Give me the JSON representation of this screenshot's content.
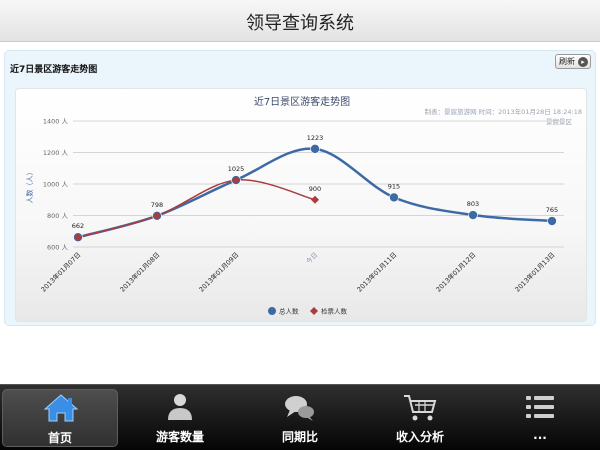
{
  "header": {
    "title": "领导查询系统"
  },
  "panel": {
    "title": "近7日景区游客走势图",
    "refresh_label": "刷新"
  },
  "chart_data": {
    "type": "line",
    "title": "近7日景区游客走势图",
    "credit_line1": "制表：景宸旅游网 时间：2013年01月28日 18:24:18",
    "credit_line2": "景宸景区",
    "ylabel": "人数（人）",
    "ylim": [
      600,
      1400
    ],
    "yticks": [
      {
        "value": 600,
        "label": "600 人"
      },
      {
        "value": 800,
        "label": "800 人"
      },
      {
        "value": 1000,
        "label": "1000 人"
      },
      {
        "value": 1200,
        "label": "1200 人"
      },
      {
        "value": 1400,
        "label": "1400 人"
      }
    ],
    "categories": [
      "2013年01月07日",
      "2013年01月08日",
      "2013年01月09日",
      "今日",
      "2013年01月11日",
      "2013年01月12日",
      "2013年01月13日"
    ],
    "series": [
      {
        "name": "总人数",
        "color": "#3d6aa5",
        "marker": "circle",
        "values": [
          662,
          798,
          1025,
          1223,
          915,
          803,
          765
        ],
        "labels": [
          "662",
          "798",
          "1025",
          "1223",
          "915",
          "803",
          "765"
        ]
      },
      {
        "name": "检票人数",
        "color": "#aa3c3c",
        "marker": "diamond",
        "values": [
          662,
          798,
          1025,
          900
        ],
        "labels": [
          "",
          "",
          "",
          "900"
        ]
      }
    ],
    "grid": true,
    "legend": "bottom-center"
  },
  "tabbar": {
    "items": [
      {
        "key": "home",
        "label": "首页",
        "icon": "home-icon",
        "active": true
      },
      {
        "key": "visitors",
        "label": "游客数量",
        "icon": "person-icon",
        "active": false
      },
      {
        "key": "compare",
        "label": "同期比",
        "icon": "chat-icon",
        "active": false
      },
      {
        "key": "income",
        "label": "收入分析",
        "icon": "cart-icon",
        "active": false
      },
      {
        "key": "more",
        "label": "...",
        "icon": "list-icon",
        "active": false
      }
    ]
  }
}
